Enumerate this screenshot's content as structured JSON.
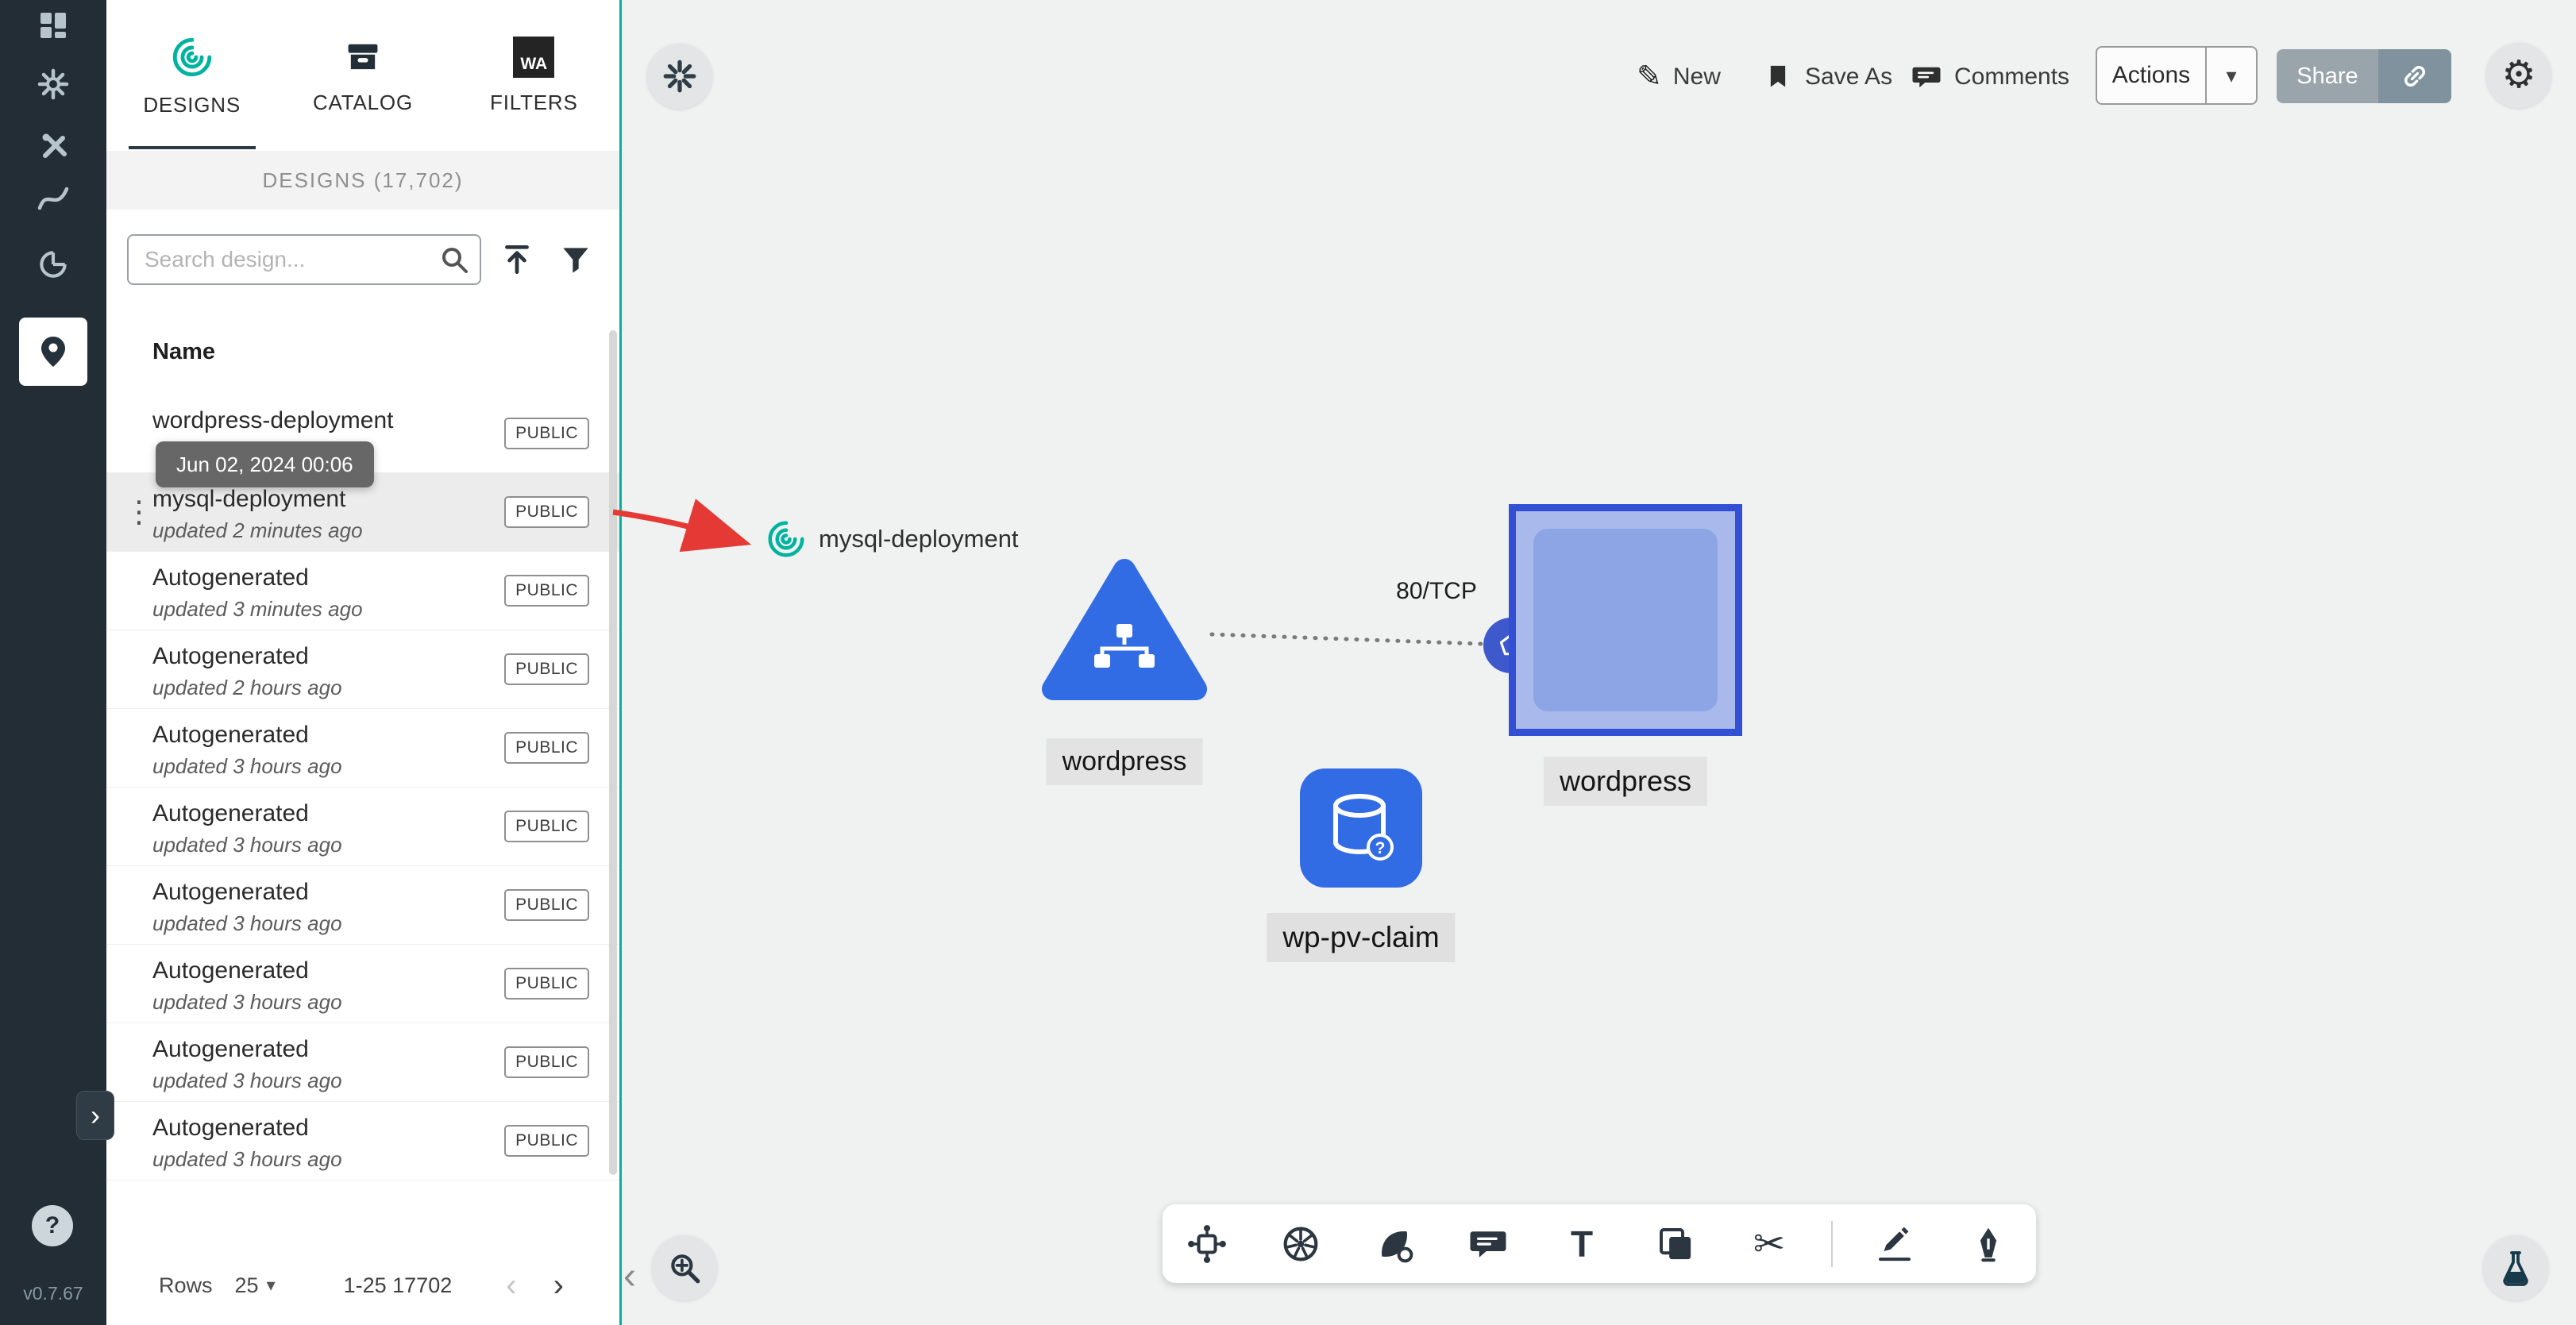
{
  "app": {
    "version": "v0.7.67"
  },
  "icons": {
    "pencil": "✎",
    "gear": "⚙",
    "caret": "▾",
    "chevron_left": "‹",
    "chevron_right": "›",
    "kebab": "⋮",
    "scissors": "✂",
    "help": "?",
    "expander": "›",
    "collapse": "‹"
  },
  "panel": {
    "tabs": [
      {
        "label": "DESIGNS"
      },
      {
        "label": "CATALOG"
      },
      {
        "label": "FILTERS"
      }
    ],
    "filters_icon_text": "WA",
    "header": "DESIGNS (17,702)",
    "search": {
      "placeholder": "Search design..."
    },
    "table": {
      "name_header": "Name"
    },
    "tooltip": "Jun 02, 2024 00:06",
    "kebab_glyph": "⋮",
    "rows": [
      {
        "name": "wordpress-deployment",
        "updated": "",
        "badge": "PUBLIC",
        "selected": false
      },
      {
        "name": "mysql-deployment",
        "updated": "updated 2 minutes ago",
        "badge": "PUBLIC",
        "selected": true
      },
      {
        "name": "Autogenerated",
        "updated": "updated 3 minutes ago",
        "badge": "PUBLIC",
        "selected": false
      },
      {
        "name": "Autogenerated",
        "updated": "updated 2 hours ago",
        "badge": "PUBLIC",
        "selected": false
      },
      {
        "name": "Autogenerated",
        "updated": "updated 3 hours ago",
        "badge": "PUBLIC",
        "selected": false
      },
      {
        "name": "Autogenerated",
        "updated": "updated 3 hours ago",
        "badge": "PUBLIC",
        "selected": false
      },
      {
        "name": "Autogenerated",
        "updated": "updated 3 hours ago",
        "badge": "PUBLIC",
        "selected": false
      },
      {
        "name": "Autogenerated",
        "updated": "updated 3 hours ago",
        "badge": "PUBLIC",
        "selected": false
      },
      {
        "name": "Autogenerated",
        "updated": "updated 3 hours ago",
        "badge": "PUBLIC",
        "selected": false
      },
      {
        "name": "Autogenerated",
        "updated": "updated 3 hours ago",
        "badge": "PUBLIC",
        "selected": false
      }
    ],
    "footer": {
      "rows_label": "Rows",
      "rows_per_page": "25",
      "range": "1-25 17702"
    }
  },
  "topbar": {
    "new": "New",
    "save_as": "Save As",
    "comments": "Comments",
    "actions": "Actions",
    "share": "Share"
  },
  "canvas": {
    "design_ref": "mysql-deployment",
    "edge_label": "80/TCP",
    "labels": {
      "triangle": "wordpress",
      "square": "wordpress",
      "pvc": "wp-pv-claim"
    },
    "pvc_badge": "?",
    "text_tool": "T",
    "bottom_tools": [
      "components",
      "kubernetes",
      "shapes",
      "comment",
      "text",
      "note",
      "scissors",
      "draw",
      "sketch"
    ]
  },
  "colors": {
    "accent_teal": "#00B39F",
    "kubernetes_blue": "#326CE5",
    "selection_blue": "#3350d5",
    "arrow_red": "#e53935",
    "sidebar_dark": "#222d36"
  }
}
